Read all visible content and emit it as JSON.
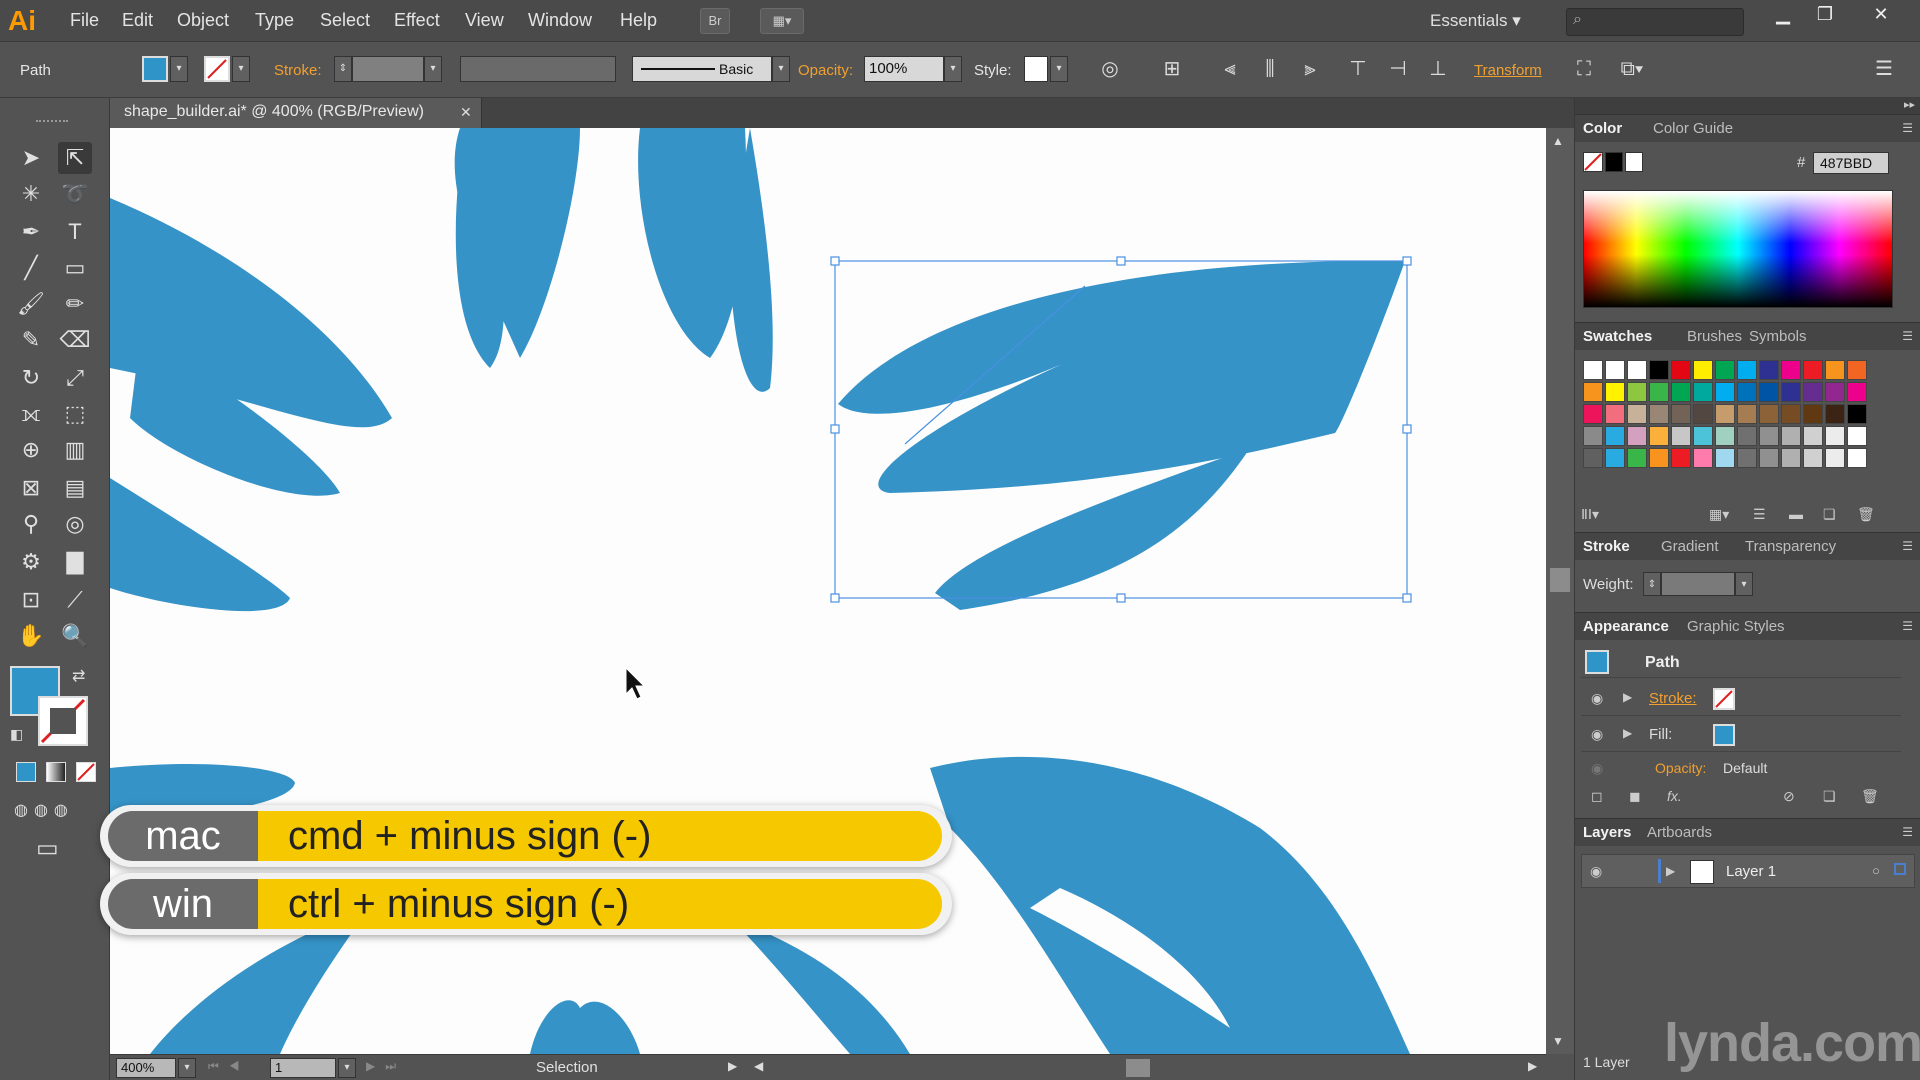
{
  "app": {
    "logo": "Ai"
  },
  "menu": [
    "File",
    "Edit",
    "Object",
    "Type",
    "Select",
    "Effect",
    "View",
    "Window",
    "Help"
  ],
  "menubar": {
    "bridge_label": "Br",
    "workspace": "Essentials"
  },
  "control": {
    "object_type": "Path",
    "stroke_label": "Stroke:",
    "brush": "Basic",
    "opacity_label": "Opacity:",
    "opacity_value": "100%",
    "style_label": "Style:",
    "transform_label": "Transform"
  },
  "document": {
    "tab_title": "shape_builder.ai* @ 400% (RGB/Preview)"
  },
  "colors": {
    "fill": "#2f95c9",
    "shape": "#3593c7"
  },
  "color_panel": {
    "tabs": [
      "Color",
      "Color Guide"
    ],
    "hex_label": "#",
    "hex_value": "487BBD"
  },
  "swatches_panel": {
    "tabs": [
      "Swatches",
      "Brushes",
      "Symbols"
    ]
  },
  "stroke_panel": {
    "tabs": [
      "Stroke",
      "Gradient",
      "Transparency"
    ],
    "weight_label": "Weight:"
  },
  "appearance_panel": {
    "tabs": [
      "Appearance",
      "Graphic Styles"
    ],
    "title": "Path",
    "stroke_label": "Stroke:",
    "fill_label": "Fill:",
    "opacity_label": "Opacity:",
    "opacity_value": "Default",
    "fx": "fx."
  },
  "layers_panel": {
    "tabs": [
      "Layers",
      "Artboards"
    ],
    "layer_name": "Layer 1",
    "footer": "1 Layer"
  },
  "status": {
    "zoom": "400%",
    "artboard": "1",
    "tool": "Selection"
  },
  "overlay": {
    "mac_label": "mac",
    "mac_keys": "cmd + minus sign (-)",
    "win_label": "win",
    "win_keys": "ctrl + minus sign (-)"
  },
  "watermark": "lynda.com"
}
